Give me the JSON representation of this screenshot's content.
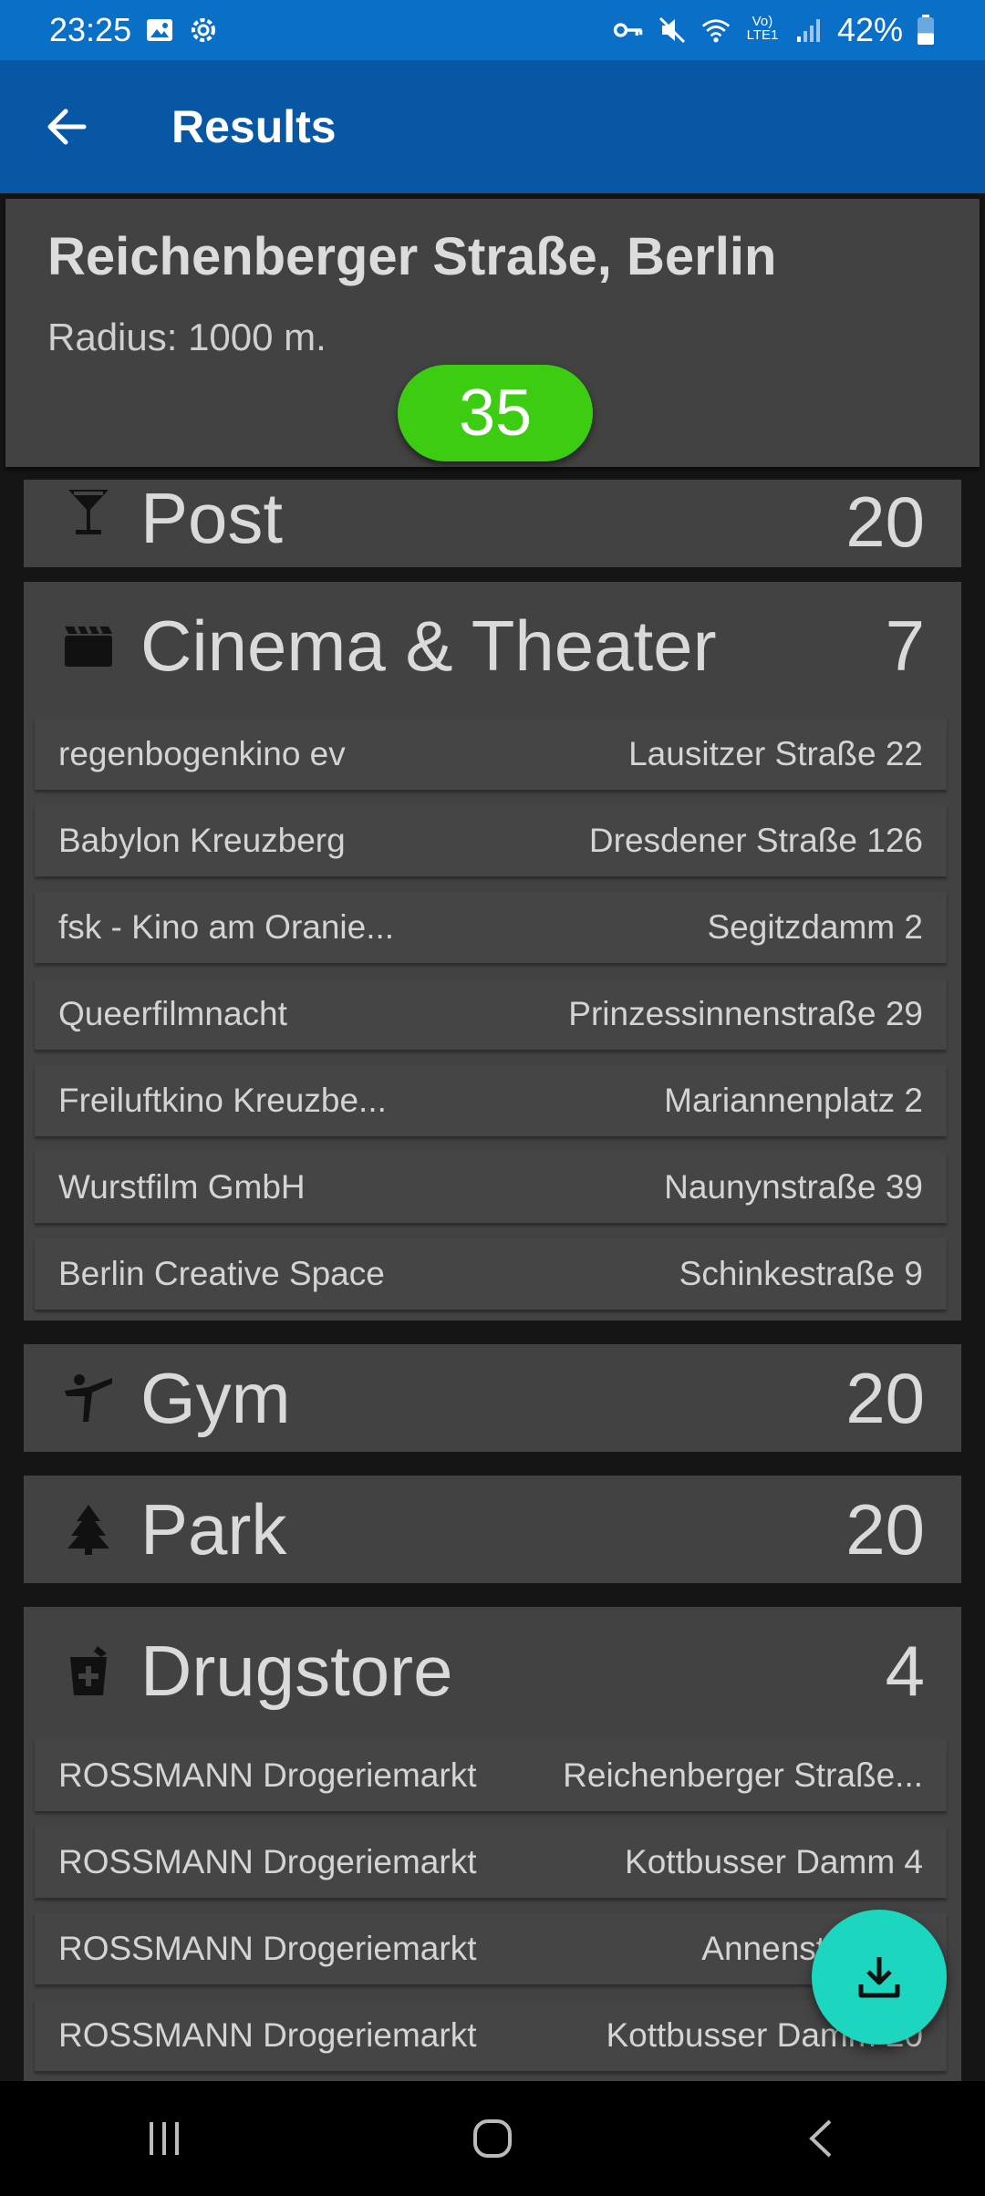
{
  "status_bar": {
    "time": "23:25",
    "battery": "42%",
    "battery_level": 0.42,
    "icons": [
      "image-icon",
      "settings-icon",
      "vpn-key-icon",
      "mute-icon",
      "wifi-icon",
      "volte-icon",
      "signal-icon",
      "battery-icon"
    ],
    "volte_label": "Vo) LTE1"
  },
  "app_bar": {
    "title": "Results"
  },
  "header": {
    "place": "Reichenberger Straße, Berlin",
    "radius": "Radius: 1000 m.",
    "total": "35",
    "total_color": "#3ccd12"
  },
  "categories": [
    {
      "name": "Post",
      "count": "20",
      "icon": "cocktail-icon",
      "items": []
    },
    {
      "name": "Cinema & Theater",
      "count": "7",
      "icon": "clapperboard-icon",
      "items": [
        {
          "name": "regenbogenkino ev",
          "address": "Lausitzer Straße 22"
        },
        {
          "name": "Babylon Kreuzberg",
          "address": "Dresdener Straße 126"
        },
        {
          "name": "fsk - Kino am Oranie...",
          "address": "Segitzdamm 2"
        },
        {
          "name": "Queerfilmnacht",
          "address": "Prinzessinnenstraße 29"
        },
        {
          "name": "Freiluftkino Kreuzbe...",
          "address": "Mariannenplatz 2"
        },
        {
          "name": "Wurstfilm GmbH",
          "address": "Naunynstraße 39"
        },
        {
          "name": "Berlin Creative Space",
          "address": "Schinkestraße 9"
        }
      ]
    },
    {
      "name": "Gym",
      "count": "20",
      "icon": "martial-arts-icon",
      "items": []
    },
    {
      "name": "Park",
      "count": "20",
      "icon": "tree-icon",
      "items": []
    },
    {
      "name": "Drugstore",
      "count": "4",
      "icon": "pharmacy-icon",
      "items": [
        {
          "name": "ROSSMANN Drogeriemarkt",
          "address": "Reichenberger Straße..."
        },
        {
          "name": "ROSSMANN Drogeriemarkt",
          "address": "Kottbusser Damm 4"
        },
        {
          "name": "ROSSMANN Drogeriemarkt",
          "address": "Annenstraße 4"
        },
        {
          "name": "ROSSMANN Drogeriemarkt",
          "address": "Kottbusser Damm 20"
        }
      ]
    }
  ],
  "fab": {
    "icon": "download-icon",
    "color": "#1dd6bf"
  },
  "nav_bar": {
    "icons": [
      "recent-apps-icon",
      "home-icon",
      "back-nav-icon"
    ]
  }
}
